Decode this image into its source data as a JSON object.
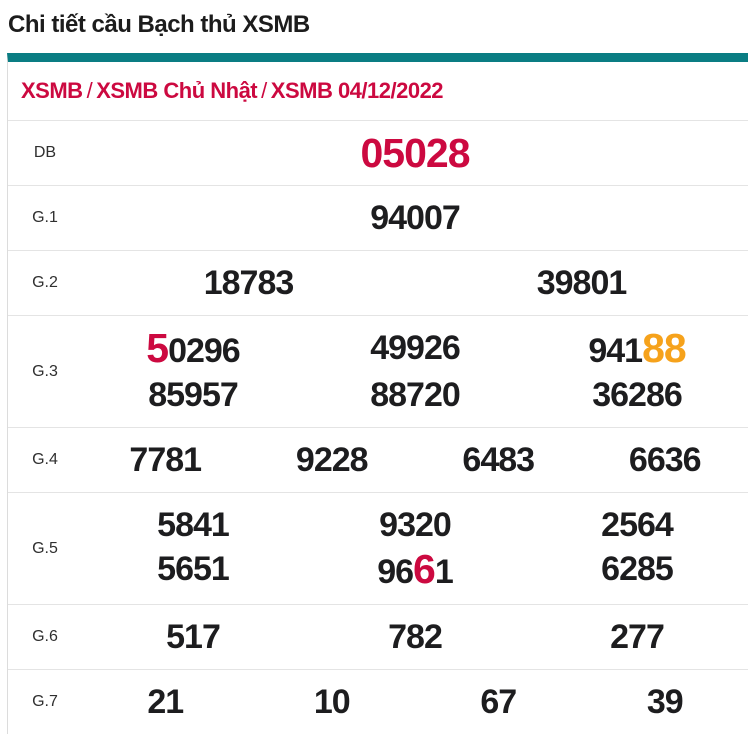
{
  "title": "Chi tiết cầu Bạch thủ XSMB",
  "breadcrumb": {
    "items": [
      "XSMB",
      "XSMB Chủ Nhật",
      "XSMB 04/12/2022"
    ],
    "separator": "/"
  },
  "colors": {
    "accent_teal": "#0a7d83",
    "highlight_red": "#cc0940",
    "highlight_orange": "#f6a21b",
    "number_dark": "#1d1d1f",
    "border_gray": "#e4e4e4"
  },
  "table": {
    "rows": [
      {
        "label": "DB",
        "emphasis": true,
        "lines": [
          [
            [
              {
                "t": "05028",
                "c": "red"
              }
            ]
          ]
        ]
      },
      {
        "label": "G.1",
        "lines": [
          [
            [
              {
                "t": "94007"
              }
            ]
          ]
        ]
      },
      {
        "label": "G.2",
        "lines": [
          [
            [
              {
                "t": "18783"
              }
            ],
            [
              {
                "t": "39801"
              }
            ]
          ]
        ]
      },
      {
        "label": "G.3",
        "lines": [
          [
            [
              {
                "t": "5",
                "c": "red",
                "big": true
              },
              {
                "t": "0296"
              }
            ],
            [
              {
                "t": "49926"
              }
            ],
            [
              {
                "t": "941"
              },
              {
                "t": "88",
                "c": "orange",
                "big": true
              }
            ]
          ],
          [
            [
              {
                "t": "85957"
              }
            ],
            [
              {
                "t": "88720"
              }
            ],
            [
              {
                "t": "36286"
              }
            ]
          ]
        ]
      },
      {
        "label": "G.4",
        "lines": [
          [
            [
              {
                "t": "7781"
              }
            ],
            [
              {
                "t": "9228"
              }
            ],
            [
              {
                "t": "6483"
              }
            ],
            [
              {
                "t": "6636"
              }
            ]
          ]
        ]
      },
      {
        "label": "G.5",
        "lines": [
          [
            [
              {
                "t": "5841"
              }
            ],
            [
              {
                "t": "9320"
              }
            ],
            [
              {
                "t": "2564"
              }
            ]
          ],
          [
            [
              {
                "t": "5651"
              }
            ],
            [
              {
                "t": "96"
              },
              {
                "t": "6",
                "c": "red",
                "big": true
              },
              {
                "t": "1"
              }
            ],
            [
              {
                "t": "6285"
              }
            ]
          ]
        ]
      },
      {
        "label": "G.6",
        "lines": [
          [
            [
              {
                "t": "517"
              }
            ],
            [
              {
                "t": "782"
              }
            ],
            [
              {
                "t": "277"
              }
            ]
          ]
        ]
      },
      {
        "label": "G.7",
        "lines": [
          [
            [
              {
                "t": "21"
              }
            ],
            [
              {
                "t": "10"
              }
            ],
            [
              {
                "t": "67"
              }
            ],
            [
              {
                "t": "39"
              }
            ]
          ]
        ]
      }
    ]
  }
}
